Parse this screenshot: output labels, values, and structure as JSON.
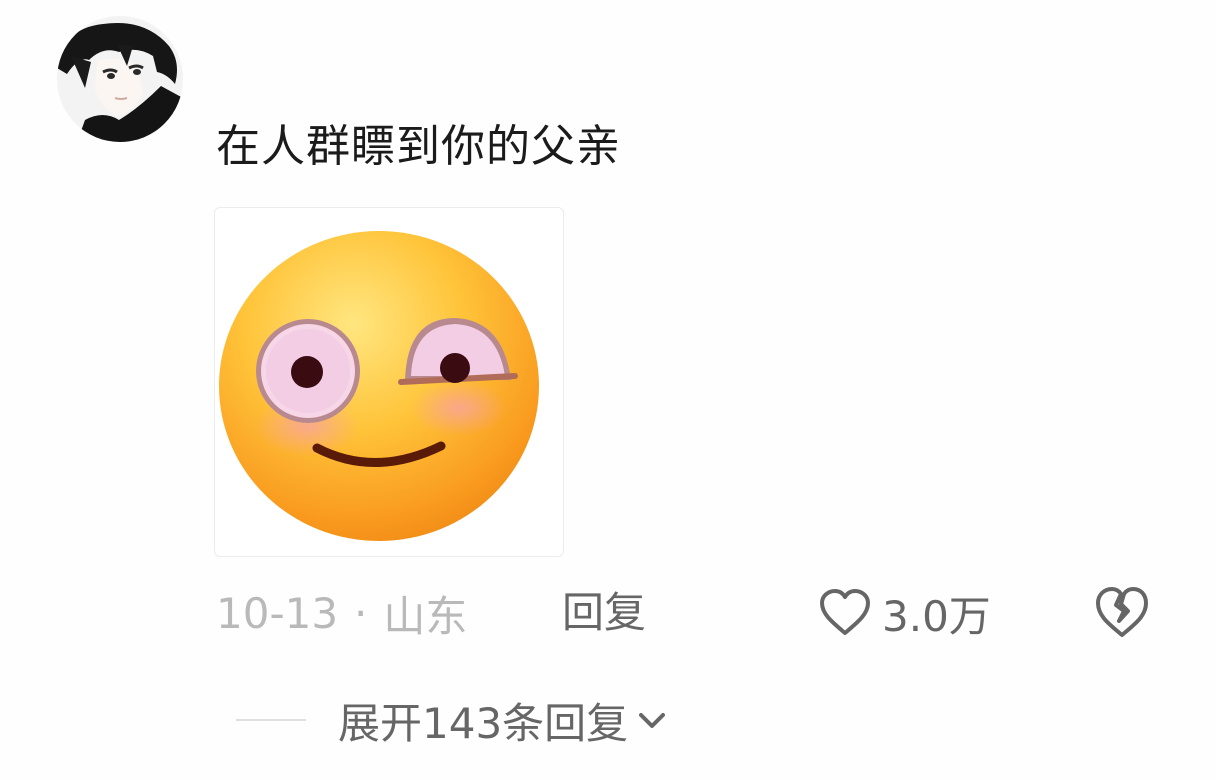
{
  "comment": {
    "avatar_icon": "anime-avatar",
    "text": "在人群瞟到你的父亲",
    "sticker_icon": "flushed-smirk-emoji",
    "date": "10-13",
    "separator": "·",
    "location": "山东",
    "reply_label": "回复",
    "like_icon": "heart-outline-icon",
    "like_count": "3.0万",
    "dislike_icon": "broken-heart-icon"
  },
  "replies": {
    "expand_label": "展开143条回复",
    "chevron_icon": "chevron-down-icon"
  },
  "colors": {
    "text_primary": "#1b1b1b",
    "text_secondary": "#666666",
    "text_muted": "#b9b9b9",
    "background": "#fefefe"
  }
}
